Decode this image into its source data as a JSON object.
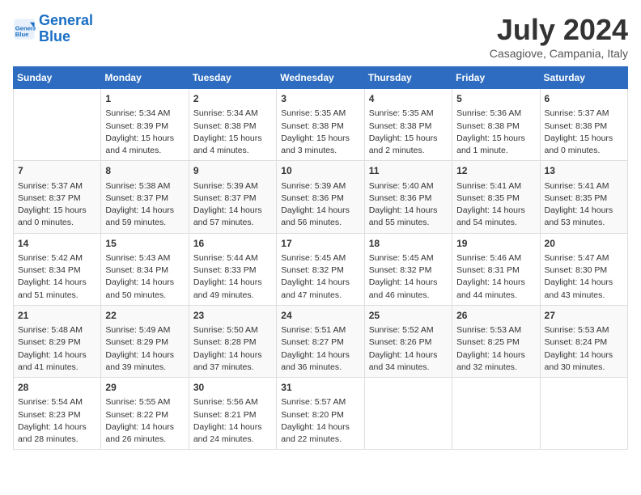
{
  "header": {
    "logo_line1": "General",
    "logo_line2": "Blue",
    "month_year": "July 2024",
    "location": "Casagiove, Campania, Italy"
  },
  "days_of_week": [
    "Sunday",
    "Monday",
    "Tuesday",
    "Wednesday",
    "Thursday",
    "Friday",
    "Saturday"
  ],
  "weeks": [
    [
      {
        "day": "",
        "content": ""
      },
      {
        "day": "1",
        "content": "Sunrise: 5:34 AM\nSunset: 8:39 PM\nDaylight: 15 hours\nand 4 minutes."
      },
      {
        "day": "2",
        "content": "Sunrise: 5:34 AM\nSunset: 8:38 PM\nDaylight: 15 hours\nand 4 minutes."
      },
      {
        "day": "3",
        "content": "Sunrise: 5:35 AM\nSunset: 8:38 PM\nDaylight: 15 hours\nand 3 minutes."
      },
      {
        "day": "4",
        "content": "Sunrise: 5:35 AM\nSunset: 8:38 PM\nDaylight: 15 hours\nand 2 minutes."
      },
      {
        "day": "5",
        "content": "Sunrise: 5:36 AM\nSunset: 8:38 PM\nDaylight: 15 hours\nand 1 minute."
      },
      {
        "day": "6",
        "content": "Sunrise: 5:37 AM\nSunset: 8:38 PM\nDaylight: 15 hours\nand 0 minutes."
      }
    ],
    [
      {
        "day": "7",
        "content": "Sunrise: 5:37 AM\nSunset: 8:37 PM\nDaylight: 15 hours\nand 0 minutes."
      },
      {
        "day": "8",
        "content": "Sunrise: 5:38 AM\nSunset: 8:37 PM\nDaylight: 14 hours\nand 59 minutes."
      },
      {
        "day": "9",
        "content": "Sunrise: 5:39 AM\nSunset: 8:37 PM\nDaylight: 14 hours\nand 57 minutes."
      },
      {
        "day": "10",
        "content": "Sunrise: 5:39 AM\nSunset: 8:36 PM\nDaylight: 14 hours\nand 56 minutes."
      },
      {
        "day": "11",
        "content": "Sunrise: 5:40 AM\nSunset: 8:36 PM\nDaylight: 14 hours\nand 55 minutes."
      },
      {
        "day": "12",
        "content": "Sunrise: 5:41 AM\nSunset: 8:35 PM\nDaylight: 14 hours\nand 54 minutes."
      },
      {
        "day": "13",
        "content": "Sunrise: 5:41 AM\nSunset: 8:35 PM\nDaylight: 14 hours\nand 53 minutes."
      }
    ],
    [
      {
        "day": "14",
        "content": "Sunrise: 5:42 AM\nSunset: 8:34 PM\nDaylight: 14 hours\nand 51 minutes."
      },
      {
        "day": "15",
        "content": "Sunrise: 5:43 AM\nSunset: 8:34 PM\nDaylight: 14 hours\nand 50 minutes."
      },
      {
        "day": "16",
        "content": "Sunrise: 5:44 AM\nSunset: 8:33 PM\nDaylight: 14 hours\nand 49 minutes."
      },
      {
        "day": "17",
        "content": "Sunrise: 5:45 AM\nSunset: 8:32 PM\nDaylight: 14 hours\nand 47 minutes."
      },
      {
        "day": "18",
        "content": "Sunrise: 5:45 AM\nSunset: 8:32 PM\nDaylight: 14 hours\nand 46 minutes."
      },
      {
        "day": "19",
        "content": "Sunrise: 5:46 AM\nSunset: 8:31 PM\nDaylight: 14 hours\nand 44 minutes."
      },
      {
        "day": "20",
        "content": "Sunrise: 5:47 AM\nSunset: 8:30 PM\nDaylight: 14 hours\nand 43 minutes."
      }
    ],
    [
      {
        "day": "21",
        "content": "Sunrise: 5:48 AM\nSunset: 8:29 PM\nDaylight: 14 hours\nand 41 minutes."
      },
      {
        "day": "22",
        "content": "Sunrise: 5:49 AM\nSunset: 8:29 PM\nDaylight: 14 hours\nand 39 minutes."
      },
      {
        "day": "23",
        "content": "Sunrise: 5:50 AM\nSunset: 8:28 PM\nDaylight: 14 hours\nand 37 minutes."
      },
      {
        "day": "24",
        "content": "Sunrise: 5:51 AM\nSunset: 8:27 PM\nDaylight: 14 hours\nand 36 minutes."
      },
      {
        "day": "25",
        "content": "Sunrise: 5:52 AM\nSunset: 8:26 PM\nDaylight: 14 hours\nand 34 minutes."
      },
      {
        "day": "26",
        "content": "Sunrise: 5:53 AM\nSunset: 8:25 PM\nDaylight: 14 hours\nand 32 minutes."
      },
      {
        "day": "27",
        "content": "Sunrise: 5:53 AM\nSunset: 8:24 PM\nDaylight: 14 hours\nand 30 minutes."
      }
    ],
    [
      {
        "day": "28",
        "content": "Sunrise: 5:54 AM\nSunset: 8:23 PM\nDaylight: 14 hours\nand 28 minutes."
      },
      {
        "day": "29",
        "content": "Sunrise: 5:55 AM\nSunset: 8:22 PM\nDaylight: 14 hours\nand 26 minutes."
      },
      {
        "day": "30",
        "content": "Sunrise: 5:56 AM\nSunset: 8:21 PM\nDaylight: 14 hours\nand 24 minutes."
      },
      {
        "day": "31",
        "content": "Sunrise: 5:57 AM\nSunset: 8:20 PM\nDaylight: 14 hours\nand 22 minutes."
      },
      {
        "day": "",
        "content": ""
      },
      {
        "day": "",
        "content": ""
      },
      {
        "day": "",
        "content": ""
      }
    ]
  ]
}
